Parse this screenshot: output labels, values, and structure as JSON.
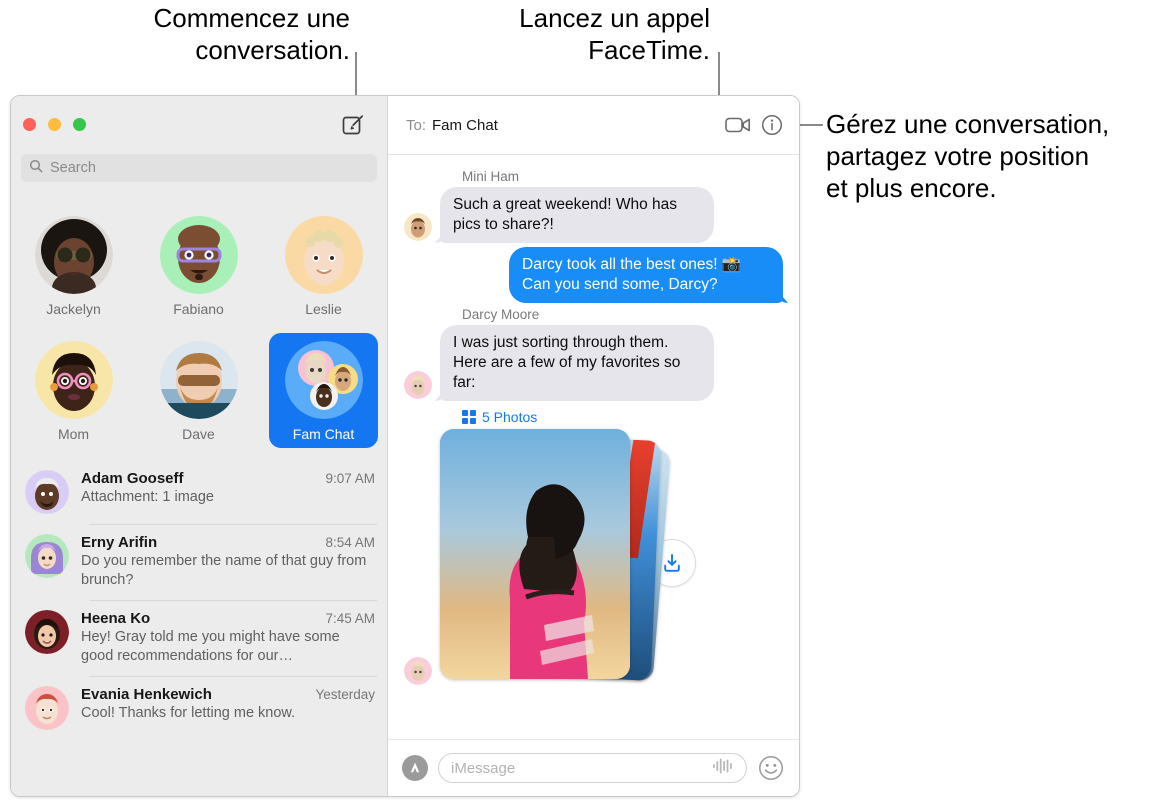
{
  "callouts": {
    "compose": "Commencez une\nconversation.",
    "facetime": "Lancez un appel\nFaceTime.",
    "manage": "Gérez une conversation,\npartagez votre position\net plus encore."
  },
  "colors": {
    "accent_blue": "#188cf7",
    "selected_tile": "#1476f0",
    "sidebar_bg": "#ececec",
    "incoming_bubble": "#e6e5eb",
    "link_blue": "#1279f2"
  },
  "window": {
    "traffic_lights": [
      "close",
      "minimize",
      "maximize"
    ]
  },
  "sidebar": {
    "compose_icon": "compose-icon",
    "search": {
      "icon": "search-icon",
      "placeholder": "Search",
      "value": ""
    },
    "pinned": [
      {
        "name": "Jackelyn",
        "selected": false
      },
      {
        "name": "Fabiano",
        "selected": false
      },
      {
        "name": "Leslie",
        "selected": false
      },
      {
        "name": "Mom",
        "selected": false
      },
      {
        "name": "Dave",
        "selected": false
      },
      {
        "name": "Fam Chat",
        "selected": true
      }
    ],
    "conversations": [
      {
        "name": "Adam Gooseff",
        "time": "9:07 AM",
        "preview": "Attachment: 1 image"
      },
      {
        "name": "Erny Arifin",
        "time": "8:54 AM",
        "preview": "Do you remember the name of that guy from brunch?"
      },
      {
        "name": "Heena Ko",
        "time": "7:45 AM",
        "preview": "Hey! Gray told me you might have some good recommendations for our…"
      },
      {
        "name": "Evania Henkewich",
        "time": "Yesterday",
        "preview": "Cool! Thanks for letting me know."
      }
    ]
  },
  "conversation": {
    "to_label": "To:",
    "to_value": "Fam Chat",
    "facetime_icon": "video-camera-icon",
    "info_icon": "info-circle-icon",
    "messages": [
      {
        "sender": "Mini Ham",
        "direction": "incoming",
        "text": "Such a great weekend! Who has pics to share?!"
      },
      {
        "sender": "",
        "direction": "outgoing",
        "text": "Darcy took all the best ones! 📸 Can you send some, Darcy?"
      },
      {
        "sender": "Darcy Moore",
        "direction": "incoming",
        "text": "I was just sorting through them. Here are a few of my favorites so far:"
      }
    ],
    "attachment": {
      "grid_icon": "grid-2x2-icon",
      "label": "5 Photos",
      "download_icon": "download-icon"
    },
    "compose_bar": {
      "appstore_icon": "app-store-icon",
      "placeholder": "iMessage",
      "value": "",
      "audio_icon": "audio-waveform-icon",
      "emoji_icon": "smiley-face-icon"
    }
  }
}
